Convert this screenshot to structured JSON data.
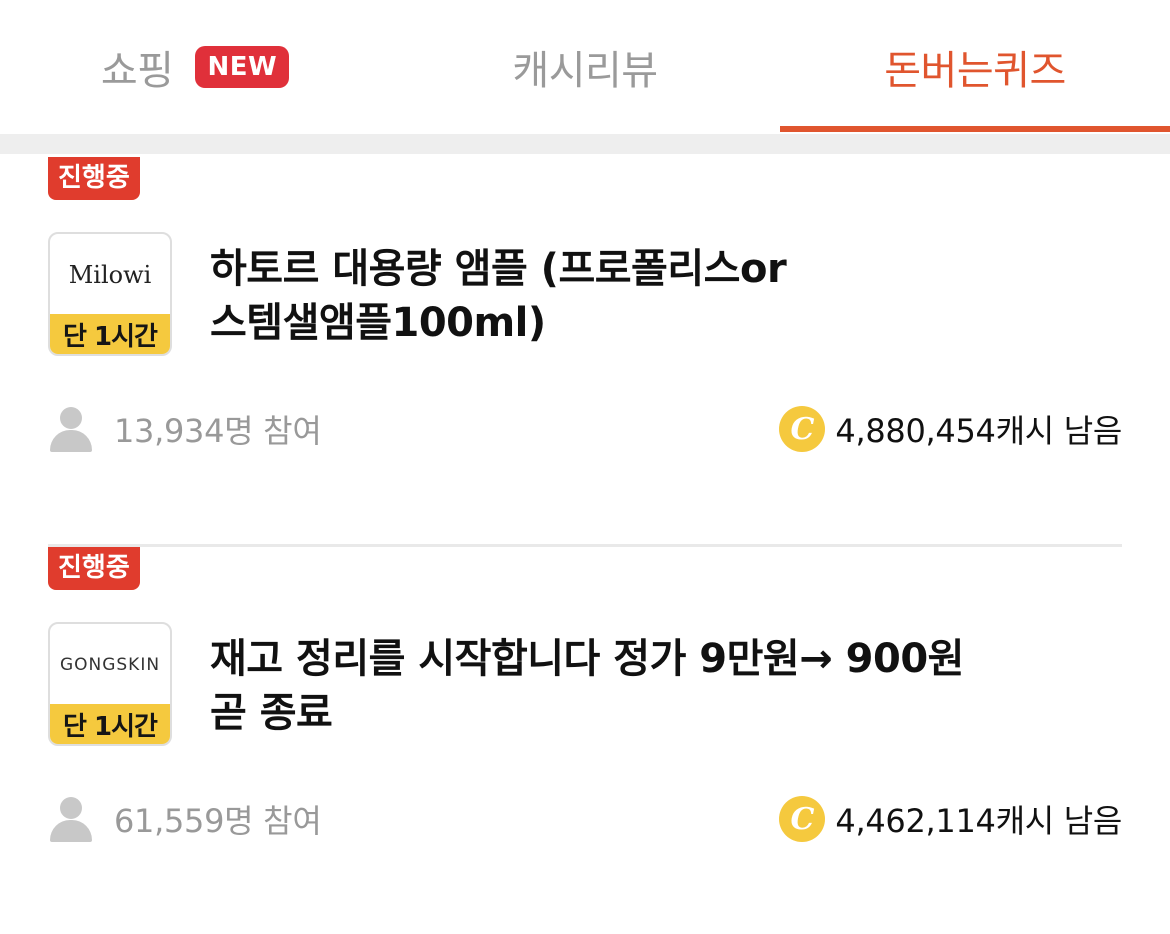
{
  "tabs": [
    {
      "label": "쇼핑",
      "badge": "NEW",
      "active": false
    },
    {
      "label": "캐시리뷰",
      "active": false
    },
    {
      "label": "돈버는퀴즈",
      "active": true
    }
  ],
  "colors": {
    "accent": "#e0552e",
    "badge_red": "#e03c2d",
    "coin_yellow": "#f5c93e",
    "muted": "#999999"
  },
  "items": [
    {
      "status": "진행중",
      "brand": "Milowi",
      "tag": "단 1시간",
      "title_line1": "하토르 대용량 앰플 (프로폴리스or",
      "title_line2": "스템샐앰플100ml)",
      "participants": "13,934명 참여",
      "remaining": "4,880,454캐시 남음",
      "coin_symbol": "C"
    },
    {
      "status": "진행중",
      "brand": "GONGSKIN",
      "tag": "단 1시간",
      "title_line1": "재고 정리를 시작합니다 정가 9만원→ 900원",
      "title_line2": "곧 종료",
      "participants": "61,559명 참여",
      "remaining": "4,462,114캐시 남음",
      "coin_symbol": "C"
    }
  ]
}
